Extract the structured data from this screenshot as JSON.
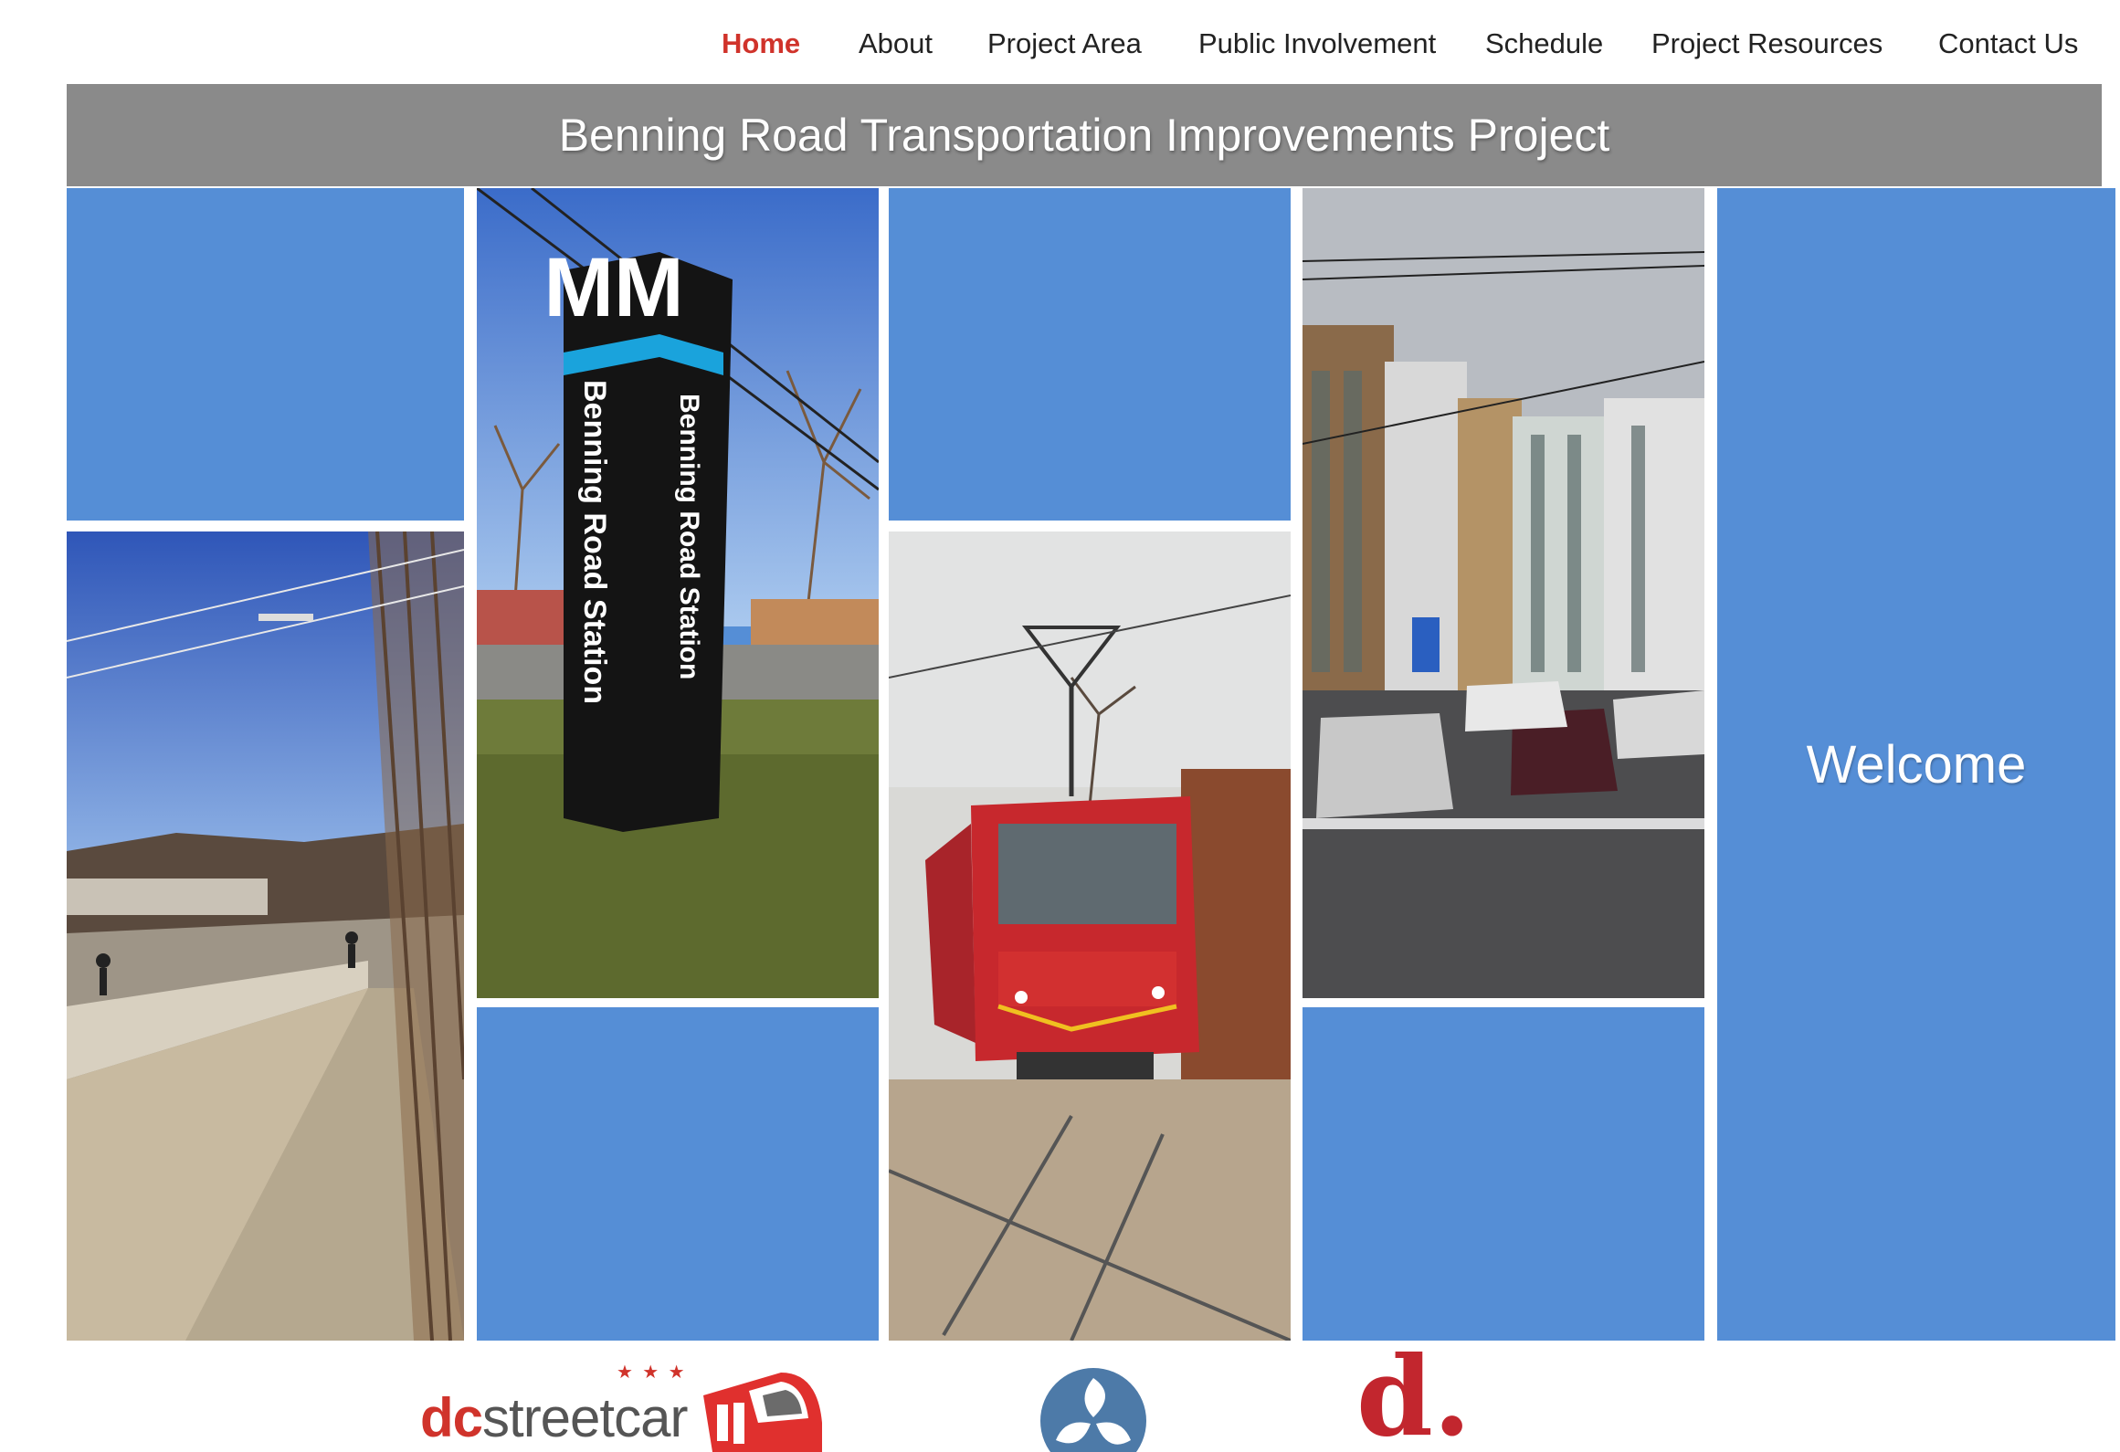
{
  "nav": {
    "items": [
      {
        "label": "Home",
        "active": true
      },
      {
        "label": "About"
      },
      {
        "label": "Project Area"
      },
      {
        "label": "Public Involvement"
      },
      {
        "label": "Schedule"
      },
      {
        "label": "Project Resources"
      },
      {
        "label": "Contact Us"
      }
    ]
  },
  "header": {
    "title": "Benning Road Transportation Improvements Project"
  },
  "tiles": {
    "station_sign_top": "MM",
    "station_sign_front": "Benning Road Station",
    "station_sign_side": "Benning Road Station",
    "welcome": "Welcome"
  },
  "logos": {
    "streetcar_dc": "dc",
    "streetcar_rest": "streetcar",
    "stars": "★ ★ ★",
    "d_logo": "d."
  },
  "colors": {
    "accent_blue": "#558ed6",
    "active_nav": "#d0332b",
    "title_band": "#8a8a8a"
  }
}
